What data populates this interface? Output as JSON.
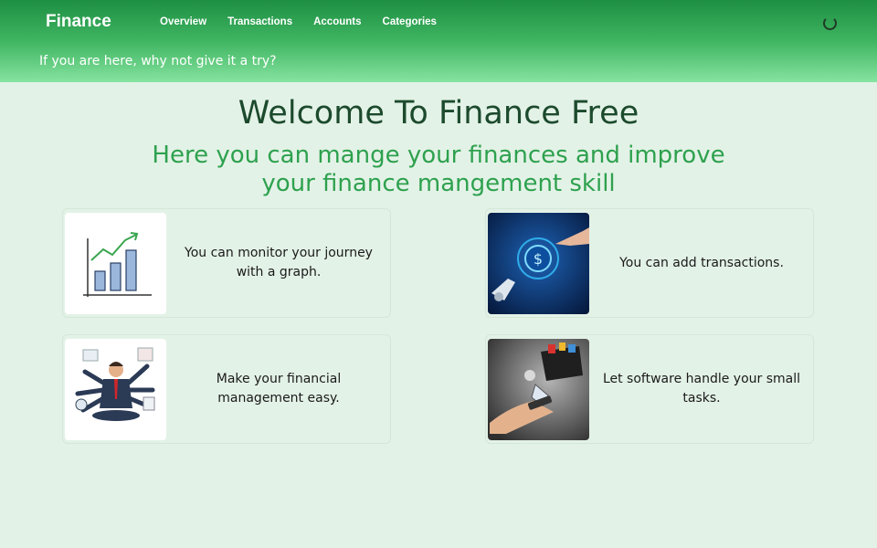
{
  "navbar": {
    "brand": "Finance",
    "links": [
      "Overview",
      "Transactions",
      "Accounts",
      "Categories"
    ],
    "tagline": "If you are here, why not give it a try?"
  },
  "main": {
    "title": "Welcome To Finance Free",
    "subtitle": "Here you can mange your finances and improve your finance mangement skill"
  },
  "cards": [
    {
      "text": "You can monitor your journey with a graph.",
      "icon": "bar-chart-illustration"
    },
    {
      "text": "You can add transactions.",
      "icon": "digital-dollar-illustration"
    },
    {
      "text": "Make your financial management easy.",
      "icon": "multitasking-businessman-illustration"
    },
    {
      "text": "Let software handle your small tasks.",
      "icon": "phone-wallet-illustration"
    }
  ],
  "colors": {
    "header_top": "#1e8f43",
    "header_bottom": "#86e3a0",
    "background": "#e3f2e7",
    "title": "#1c4a2d",
    "subtitle": "#2ea14e"
  }
}
